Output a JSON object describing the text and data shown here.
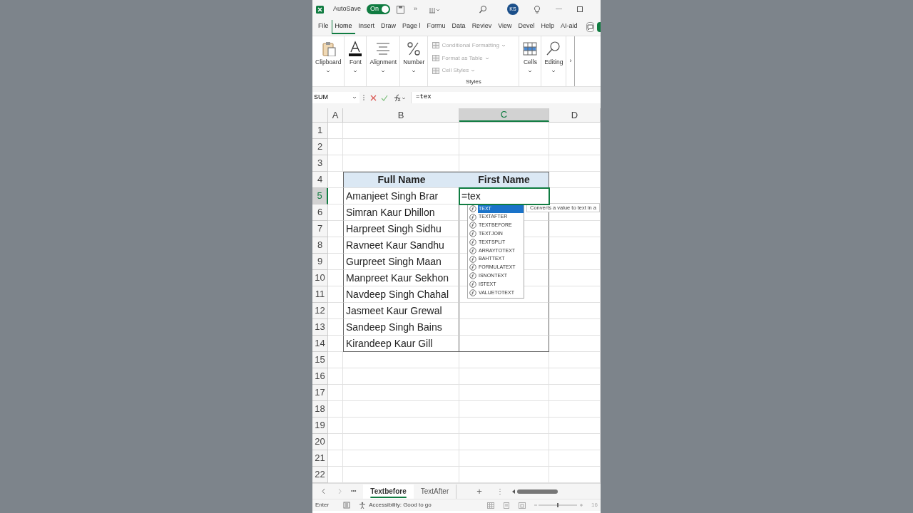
{
  "title_bar": {
    "autosave_label": "AutoSave",
    "autosave_toggle": {
      "label": "On",
      "on": true
    },
    "overflow": "»",
    "user_initials": "KS",
    "minimize": "—"
  },
  "tabs": [
    {
      "label": "File",
      "selected": false
    },
    {
      "label": "Home",
      "selected": true
    },
    {
      "label": "Insert",
      "selected": false
    },
    {
      "label": "Draw",
      "selected": false
    },
    {
      "label": "Page l",
      "selected": false
    },
    {
      "label": "Formu",
      "selected": false
    },
    {
      "label": "Data",
      "selected": false
    },
    {
      "label": "Reviev",
      "selected": false
    },
    {
      "label": "View",
      "selected": false
    },
    {
      "label": "Devel",
      "selected": false
    },
    {
      "label": "Help",
      "selected": false
    },
    {
      "label": "AI-aid",
      "selected": false
    }
  ],
  "ribbon": {
    "groups_left": [
      {
        "label": "Clipboard",
        "kind": "clipboard"
      },
      {
        "label": "Font",
        "kind": "font"
      },
      {
        "label": "Alignment",
        "kind": "alignment"
      },
      {
        "label": "Number",
        "kind": "number"
      }
    ],
    "styles": {
      "items": [
        {
          "label": "Conditional Formatting",
          "disabled": true
        },
        {
          "label": "Format as Table",
          "disabled": true
        },
        {
          "label": "Cell Styles",
          "disabled": true
        }
      ],
      "label": "Styles"
    },
    "groups_right": [
      {
        "label": "Cells",
        "kind": "cells"
      },
      {
        "label": "Editing",
        "kind": "editing"
      }
    ],
    "scroll": "›"
  },
  "formula_bar": {
    "name_box": "SUM",
    "formula": "=tex"
  },
  "columns": [
    {
      "label": "A",
      "selected": false
    },
    {
      "label": "B",
      "selected": false
    },
    {
      "label": "C",
      "selected": true
    },
    {
      "label": "D",
      "selected": false
    }
  ],
  "rows": [
    {
      "label": "1",
      "kind": "plain",
      "active": false
    },
    {
      "label": "2",
      "kind": "plain",
      "active": false
    },
    {
      "label": "3",
      "kind": "plain",
      "active": false
    },
    {
      "label": "4",
      "kind": "table_header",
      "active": false,
      "cells": [
        "Full Name",
        "First Name"
      ]
    },
    {
      "label": "5",
      "kind": "table_row",
      "active": true,
      "cells": [
        "Amanjeet Singh Brar",
        "=tex"
      ]
    },
    {
      "label": "6",
      "kind": "table_row",
      "active": false,
      "cells": [
        "Simran Kaur Dhillon"
      ]
    },
    {
      "label": "7",
      "kind": "table_row",
      "active": false,
      "cells": [
        "Harpreet Singh Sidhu"
      ]
    },
    {
      "label": "8",
      "kind": "table_row",
      "active": false,
      "cells": [
        "Ravneet Kaur Sandhu"
      ]
    },
    {
      "label": "9",
      "kind": "table_row",
      "active": false,
      "cells": [
        "Gurpreet Singh Maan"
      ]
    },
    {
      "label": "10",
      "kind": "table_row",
      "active": false,
      "cells": [
        "Manpreet Kaur Sekhon"
      ]
    },
    {
      "label": "11",
      "kind": "table_row",
      "active": false,
      "cells": [
        "Navdeep Singh Chahal"
      ]
    },
    {
      "label": "12",
      "kind": "table_row",
      "active": false,
      "cells": [
        "Jasmeet Kaur Grewal"
      ]
    },
    {
      "label": "13",
      "kind": "table_row",
      "active": false,
      "cells": [
        "Sandeep Singh Bains"
      ]
    },
    {
      "label": "14",
      "kind": "table_last",
      "active": false,
      "cells": [
        "Kirandeep Kaur Gill"
      ]
    },
    {
      "label": "15",
      "kind": "plain",
      "active": false
    },
    {
      "label": "16",
      "kind": "plain",
      "active": false
    },
    {
      "label": "17",
      "kind": "plain",
      "active": false
    },
    {
      "label": "18",
      "kind": "plain",
      "active": false
    },
    {
      "label": "19",
      "kind": "plain",
      "active": false
    },
    {
      "label": "20",
      "kind": "plain",
      "active": false
    },
    {
      "label": "21",
      "kind": "plain",
      "active": false
    },
    {
      "label": "22",
      "kind": "plain",
      "active": false
    }
  ],
  "autocomplete": {
    "items": [
      {
        "label": "TEXT",
        "selected": true
      },
      {
        "label": "TEXTAFTER",
        "selected": false
      },
      {
        "label": "TEXTBEFORE",
        "selected": false
      },
      {
        "label": "TEXTJOIN",
        "selected": false
      },
      {
        "label": "TEXTSPLIT",
        "selected": false
      },
      {
        "label": "ARRAYTOTEXT",
        "selected": false
      },
      {
        "label": "BAHTTEXT",
        "selected": false
      },
      {
        "label": "FORMULATEXT",
        "selected": false
      },
      {
        "label": "ISNONTEXT",
        "selected": false
      },
      {
        "label": "ISTEXT",
        "selected": false
      },
      {
        "label": "VALUETOTEXT",
        "selected": false
      }
    ],
    "tooltip": "Converts a value to text in a"
  },
  "sheet_tabs": [
    {
      "label": "Textbefore",
      "selected": true
    },
    {
      "label": "TextAfter",
      "selected": false
    }
  ],
  "sheet_nav": {
    "more": "•••",
    "add": "+",
    "options": "⋮"
  },
  "status_bar": {
    "mode": "Enter",
    "accessibility": "Accessibility: Good to go",
    "zoom": "16"
  }
}
